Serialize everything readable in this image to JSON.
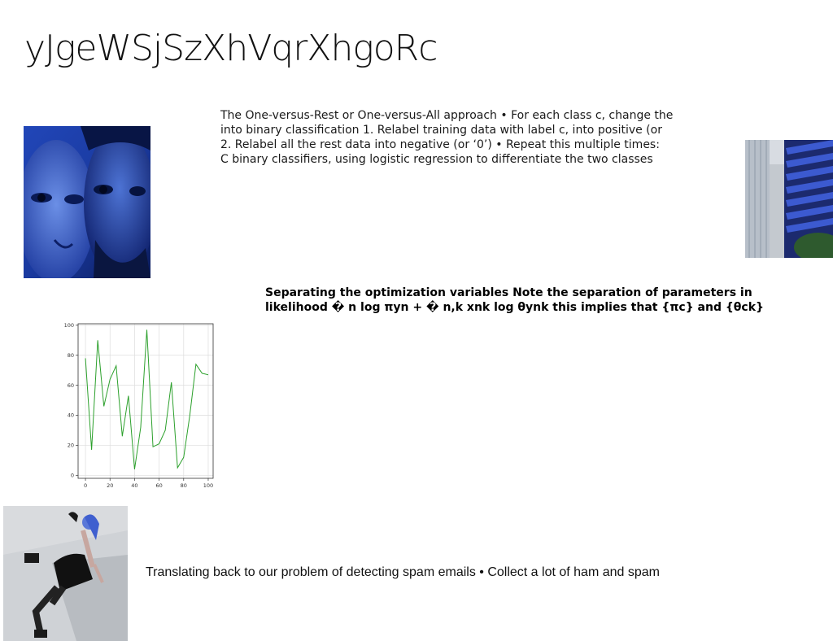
{
  "slide": {
    "title": "yJgeWSjSzXhVqrXhgoRc",
    "paragraph1_lines": [
      "The One-versus-Rest or One-versus-All approach • For each class c, change the",
      "into binary classification 1. Relabel training data with label c, into positive (or",
      "2. Relabel all the rest data into negative (or ‘0’) • Repeat this multiple times:",
      "C binary classifiers, using logistic regression to differentiate the two classes"
    ],
    "paragraph2_lines": [
      "Separating the optimization variables Note the separation of parameters in",
      "likelihood � n log πyn + � n,k xnk log θynk this implies that {πc} and {θck}"
    ],
    "paragraph3": "Translating back to our problem of detecting spam emails • Collect a lot of ham and spam"
  },
  "images": {
    "faces": "two faces in blue tint",
    "building": "skyscraper with blue facade",
    "figure": "person in black dress on grey floor"
  },
  "colors": {
    "line": "#2ca02c",
    "grid": "#dddddd",
    "blue_dark": "#0a1f66",
    "blue_mid": "#3a62c4"
  },
  "chart_data": {
    "type": "line",
    "x": [
      0,
      5,
      10,
      15,
      20,
      25,
      30,
      35,
      40,
      45,
      50,
      55,
      60,
      65,
      70,
      75,
      80,
      85,
      90,
      95,
      100
    ],
    "series": [
      {
        "values": [
          78,
          17,
          90,
          46,
          64,
          73,
          26,
          53,
          4,
          32,
          97,
          19,
          21,
          30,
          62,
          5,
          12,
          40,
          74,
          68,
          67
        ]
      }
    ],
    "xticks": [
      0,
      20,
      40,
      60,
      80,
      100
    ],
    "yticks": [
      0,
      20,
      40,
      60,
      80,
      100
    ],
    "xlim": [
      -6,
      104
    ],
    "ylim": [
      -2,
      101
    ],
    "title": "",
    "xlabel": "",
    "ylabel": "",
    "grid": true
  }
}
